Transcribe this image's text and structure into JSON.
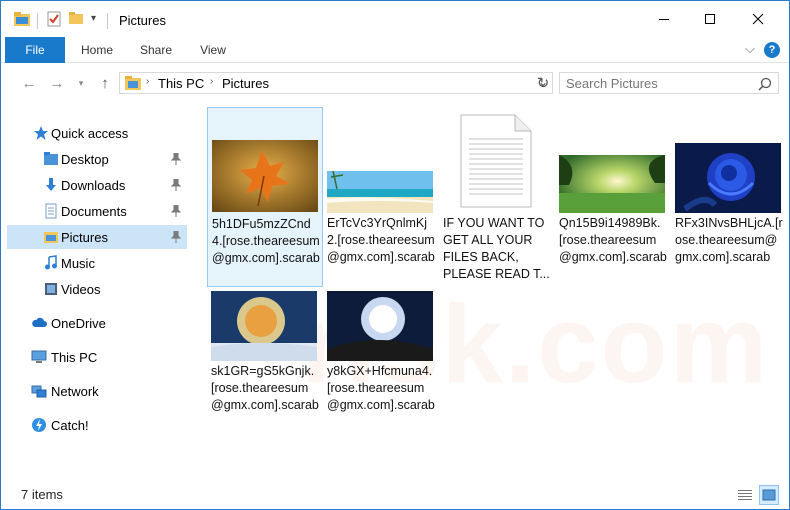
{
  "window": {
    "title": "Pictures"
  },
  "ribbon": {
    "tabs": [
      "File",
      "Home",
      "Share",
      "View"
    ],
    "help": "?"
  },
  "address": {
    "crumbs": [
      "This PC",
      "Pictures"
    ],
    "search_placeholder": "Search Pictures"
  },
  "sidebar": {
    "quick_access": "Quick access",
    "items": [
      "Desktop",
      "Downloads",
      "Documents",
      "Pictures",
      "Music",
      "Videos"
    ],
    "onedrive": "OneDrive",
    "this_pc": "This PC",
    "network": "Network",
    "catch": "Catch!"
  },
  "files": [
    "5h1DFu5mzZCnd4.[rose.theareesum@gmx.com].scarab",
    "ErTcVc3YrQnlmKj2.[rose.theareesum@gmx.com].scarab",
    "IF YOU WANT TO GET ALL YOUR FILES BACK, PLEASE READ T...",
    "Qn15B9i14989Bk.[rose.theareesum@gmx.com].scarab",
    "RFx3INvsBHLjcA.[rose.theareesum@gmx.com].scarab",
    "sk1GR=gS5kGnjk.[rose.theareesum@gmx.com].scarab",
    "y8kGX+Hfcmuna4.[rose.theareesum@gmx.com].scarab"
  ],
  "status": {
    "items": "7 items"
  },
  "colors": {
    "accent": "#1979ca",
    "selected": "#cce4f7",
    "hover_border": "#99c9ef"
  },
  "watermark": "risk.com"
}
